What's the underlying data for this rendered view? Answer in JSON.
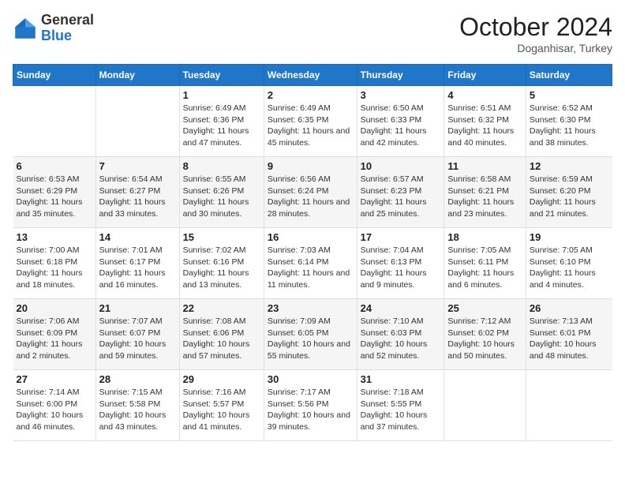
{
  "header": {
    "logo": {
      "general": "General",
      "blue": "Blue"
    },
    "title": "October 2024",
    "location": "Doganhisar, Turkey"
  },
  "weekdays": [
    "Sunday",
    "Monday",
    "Tuesday",
    "Wednesday",
    "Thursday",
    "Friday",
    "Saturday"
  ],
  "weeks": [
    [
      {
        "day": "",
        "sunrise": "",
        "sunset": "",
        "daylight": ""
      },
      {
        "day": "",
        "sunrise": "",
        "sunset": "",
        "daylight": ""
      },
      {
        "day": "1",
        "sunrise": "Sunrise: 6:49 AM",
        "sunset": "Sunset: 6:36 PM",
        "daylight": "Daylight: 11 hours and 47 minutes."
      },
      {
        "day": "2",
        "sunrise": "Sunrise: 6:49 AM",
        "sunset": "Sunset: 6:35 PM",
        "daylight": "Daylight: 11 hours and 45 minutes."
      },
      {
        "day": "3",
        "sunrise": "Sunrise: 6:50 AM",
        "sunset": "Sunset: 6:33 PM",
        "daylight": "Daylight: 11 hours and 42 minutes."
      },
      {
        "day": "4",
        "sunrise": "Sunrise: 6:51 AM",
        "sunset": "Sunset: 6:32 PM",
        "daylight": "Daylight: 11 hours and 40 minutes."
      },
      {
        "day": "5",
        "sunrise": "Sunrise: 6:52 AM",
        "sunset": "Sunset: 6:30 PM",
        "daylight": "Daylight: 11 hours and 38 minutes."
      }
    ],
    [
      {
        "day": "6",
        "sunrise": "Sunrise: 6:53 AM",
        "sunset": "Sunset: 6:29 PM",
        "daylight": "Daylight: 11 hours and 35 minutes."
      },
      {
        "day": "7",
        "sunrise": "Sunrise: 6:54 AM",
        "sunset": "Sunset: 6:27 PM",
        "daylight": "Daylight: 11 hours and 33 minutes."
      },
      {
        "day": "8",
        "sunrise": "Sunrise: 6:55 AM",
        "sunset": "Sunset: 6:26 PM",
        "daylight": "Daylight: 11 hours and 30 minutes."
      },
      {
        "day": "9",
        "sunrise": "Sunrise: 6:56 AM",
        "sunset": "Sunset: 6:24 PM",
        "daylight": "Daylight: 11 hours and 28 minutes."
      },
      {
        "day": "10",
        "sunrise": "Sunrise: 6:57 AM",
        "sunset": "Sunset: 6:23 PM",
        "daylight": "Daylight: 11 hours and 25 minutes."
      },
      {
        "day": "11",
        "sunrise": "Sunrise: 6:58 AM",
        "sunset": "Sunset: 6:21 PM",
        "daylight": "Daylight: 11 hours and 23 minutes."
      },
      {
        "day": "12",
        "sunrise": "Sunrise: 6:59 AM",
        "sunset": "Sunset: 6:20 PM",
        "daylight": "Daylight: 11 hours and 21 minutes."
      }
    ],
    [
      {
        "day": "13",
        "sunrise": "Sunrise: 7:00 AM",
        "sunset": "Sunset: 6:18 PM",
        "daylight": "Daylight: 11 hours and 18 minutes."
      },
      {
        "day": "14",
        "sunrise": "Sunrise: 7:01 AM",
        "sunset": "Sunset: 6:17 PM",
        "daylight": "Daylight: 11 hours and 16 minutes."
      },
      {
        "day": "15",
        "sunrise": "Sunrise: 7:02 AM",
        "sunset": "Sunset: 6:16 PM",
        "daylight": "Daylight: 11 hours and 13 minutes."
      },
      {
        "day": "16",
        "sunrise": "Sunrise: 7:03 AM",
        "sunset": "Sunset: 6:14 PM",
        "daylight": "Daylight: 11 hours and 11 minutes."
      },
      {
        "day": "17",
        "sunrise": "Sunrise: 7:04 AM",
        "sunset": "Sunset: 6:13 PM",
        "daylight": "Daylight: 11 hours and 9 minutes."
      },
      {
        "day": "18",
        "sunrise": "Sunrise: 7:05 AM",
        "sunset": "Sunset: 6:11 PM",
        "daylight": "Daylight: 11 hours and 6 minutes."
      },
      {
        "day": "19",
        "sunrise": "Sunrise: 7:05 AM",
        "sunset": "Sunset: 6:10 PM",
        "daylight": "Daylight: 11 hours and 4 minutes."
      }
    ],
    [
      {
        "day": "20",
        "sunrise": "Sunrise: 7:06 AM",
        "sunset": "Sunset: 6:09 PM",
        "daylight": "Daylight: 11 hours and 2 minutes."
      },
      {
        "day": "21",
        "sunrise": "Sunrise: 7:07 AM",
        "sunset": "Sunset: 6:07 PM",
        "daylight": "Daylight: 10 hours and 59 minutes."
      },
      {
        "day": "22",
        "sunrise": "Sunrise: 7:08 AM",
        "sunset": "Sunset: 6:06 PM",
        "daylight": "Daylight: 10 hours and 57 minutes."
      },
      {
        "day": "23",
        "sunrise": "Sunrise: 7:09 AM",
        "sunset": "Sunset: 6:05 PM",
        "daylight": "Daylight: 10 hours and 55 minutes."
      },
      {
        "day": "24",
        "sunrise": "Sunrise: 7:10 AM",
        "sunset": "Sunset: 6:03 PM",
        "daylight": "Daylight: 10 hours and 52 minutes."
      },
      {
        "day": "25",
        "sunrise": "Sunrise: 7:12 AM",
        "sunset": "Sunset: 6:02 PM",
        "daylight": "Daylight: 10 hours and 50 minutes."
      },
      {
        "day": "26",
        "sunrise": "Sunrise: 7:13 AM",
        "sunset": "Sunset: 6:01 PM",
        "daylight": "Daylight: 10 hours and 48 minutes."
      }
    ],
    [
      {
        "day": "27",
        "sunrise": "Sunrise: 7:14 AM",
        "sunset": "Sunset: 6:00 PM",
        "daylight": "Daylight: 10 hours and 46 minutes."
      },
      {
        "day": "28",
        "sunrise": "Sunrise: 7:15 AM",
        "sunset": "Sunset: 5:58 PM",
        "daylight": "Daylight: 10 hours and 43 minutes."
      },
      {
        "day": "29",
        "sunrise": "Sunrise: 7:16 AM",
        "sunset": "Sunset: 5:57 PM",
        "daylight": "Daylight: 10 hours and 41 minutes."
      },
      {
        "day": "30",
        "sunrise": "Sunrise: 7:17 AM",
        "sunset": "Sunset: 5:56 PM",
        "daylight": "Daylight: 10 hours and 39 minutes."
      },
      {
        "day": "31",
        "sunrise": "Sunrise: 7:18 AM",
        "sunset": "Sunset: 5:55 PM",
        "daylight": "Daylight: 10 hours and 37 minutes."
      },
      {
        "day": "",
        "sunrise": "",
        "sunset": "",
        "daylight": ""
      },
      {
        "day": "",
        "sunrise": "",
        "sunset": "",
        "daylight": ""
      }
    ]
  ]
}
